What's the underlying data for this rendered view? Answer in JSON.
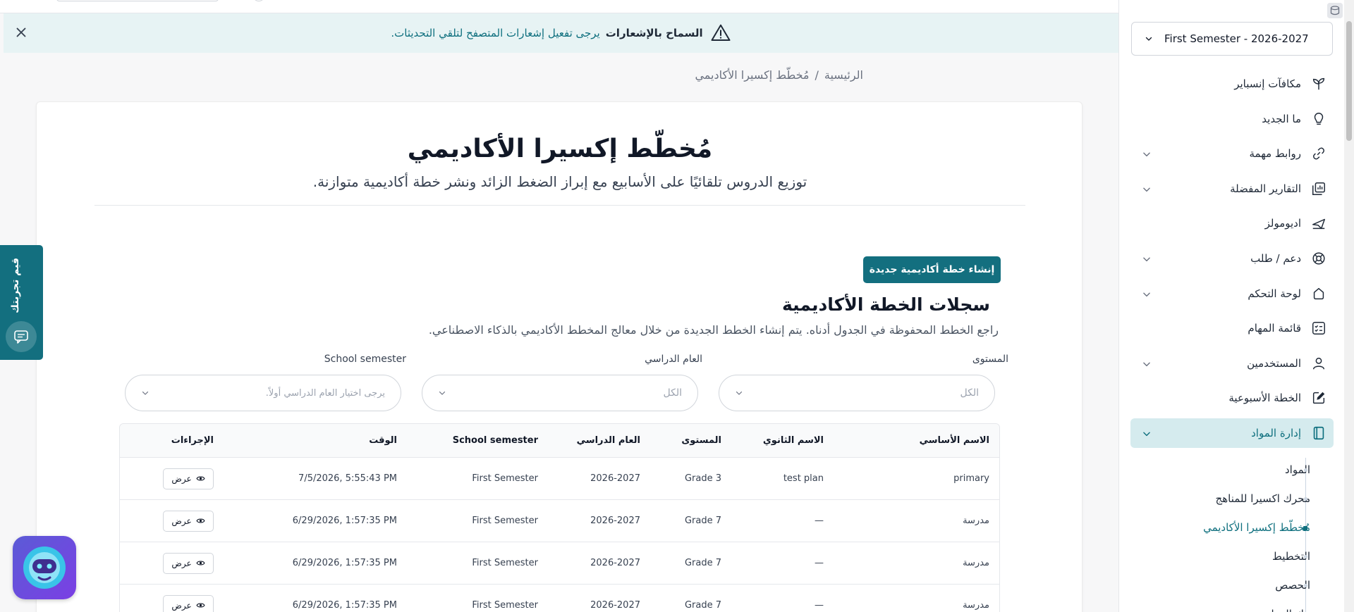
{
  "notification": {
    "title": "السماح بالإشعارات",
    "message": "يرجى تفعيل إشعارات المتصفح لتلقي التحديثات."
  },
  "breadcrumb": {
    "home": "الرئيسية",
    "separator": "/",
    "current": "مُخطّط إكسيرا الأكاديمي"
  },
  "header": {
    "title": "مُخطّط إكسيرا الأكاديمي",
    "subtitle": "توزيع الدروس تلقائيًا على الأسابيع مع إبراز الضغط الزائد ونشر خطة أكاديمية متوازنة."
  },
  "actions": {
    "new_plan": "إنشاء خطة أكاديمية جديدة"
  },
  "records": {
    "title": "سجلات الخطة الأكاديمية",
    "subtitle": "راجع الخطط المحفوظة في الجدول أدناه. يتم إنشاء الخطط الجديدة من خلال معالج المخطط الأكاديمي بالذكاء الاصطناعي."
  },
  "filters": {
    "level_label": "المستوى",
    "level_value": "الكل",
    "year_label": "العام الدراسي",
    "year_value": "الكل",
    "semester_label": "School semester",
    "semester_placeholder": "يرجى اختيار العام الدراسي أولاً."
  },
  "table": {
    "headers": {
      "primary_name": "الاسم الأساسي",
      "secondary_name": "الاسم الثانوي",
      "level": "المستوى",
      "year": "العام الدراسي",
      "semester": "School semester",
      "time": "الوقت",
      "actions": "الإجراءات"
    },
    "view_label": "عرض",
    "rows": [
      {
        "primary_name": "primary",
        "secondary_name": "test plan",
        "level": "Grade 3",
        "year": "2026-2027",
        "semester": "First Semester",
        "time": "7/5/2026, 5:55:43 PM"
      },
      {
        "primary_name": "مدرسة",
        "secondary_name": "—",
        "level": "Grade 7",
        "year": "2026-2027",
        "semester": "First Semester",
        "time": "6/29/2026, 1:57:35 PM"
      },
      {
        "primary_name": "مدرسة",
        "secondary_name": "—",
        "level": "Grade 7",
        "year": "2026-2027",
        "semester": "First Semester",
        "time": "6/29/2026, 1:57:35 PM"
      },
      {
        "primary_name": "مدرسة",
        "secondary_name": "—",
        "level": "Grade 7",
        "year": "2026-2027",
        "semester": "First Semester",
        "time": "6/29/2026, 1:57:35 PM"
      }
    ]
  },
  "feedback_tab": {
    "label": "قيم تجربتك"
  },
  "sidebar": {
    "semester": "First Semester - 2026-2027",
    "items": [
      {
        "label": "مكافآت إنسباير",
        "icon": "sprout-icon",
        "expandable": false
      },
      {
        "label": "ما الجديد",
        "icon": "lightbulb-icon",
        "expandable": false
      },
      {
        "label": "روابط مهمة",
        "icon": "link-icon",
        "expandable": true
      },
      {
        "label": "التقارير المفضلة",
        "icon": "reports-icon",
        "expandable": true
      },
      {
        "label": "اديومولز",
        "icon": "plane-icon",
        "expandable": false
      },
      {
        "label": "دعم / طلب",
        "icon": "lifebuoy-icon",
        "expandable": true
      },
      {
        "label": "لوحة التحكم",
        "icon": "dashboard-icon",
        "expandable": true
      },
      {
        "label": "قائمة المهام",
        "icon": "checklist-icon",
        "expandable": false
      },
      {
        "label": "المستخدمين",
        "icon": "user-icon",
        "expandable": true
      },
      {
        "label": "الخطة الأسبوعية",
        "icon": "edit-icon",
        "expandable": false
      },
      {
        "label": "إدارة المواد",
        "icon": "book-icon",
        "expandable": true,
        "active": true
      }
    ],
    "subitems": [
      {
        "label": "المواد"
      },
      {
        "label": "محرك اكسيرا للمناهج"
      },
      {
        "label": "مُخطّط إكسيرا الأكاديمي",
        "active": true
      },
      {
        "label": "التخطيط"
      },
      {
        "label": "الحصص"
      },
      {
        "label": "بنك المواد"
      }
    ]
  },
  "colors": {
    "accent": "#136f7f",
    "accent_text": "#0e6f7e",
    "active_bg": "#d5ebee",
    "banner_bg": "#e7f3f4"
  }
}
